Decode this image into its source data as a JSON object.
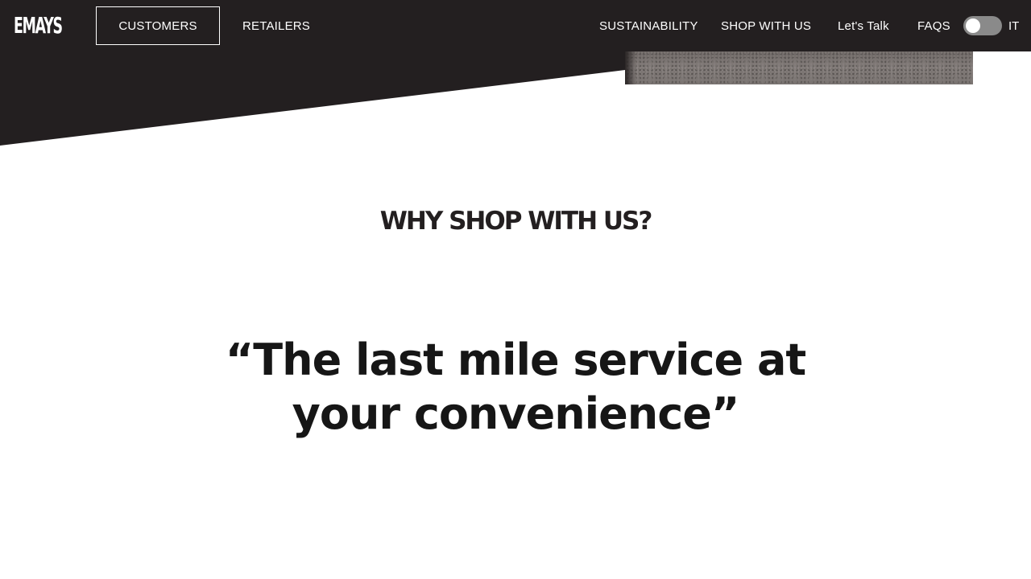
{
  "header": {
    "logo_text": "EMAYS",
    "nav_left": {
      "customers_label": "CUSTOMERS",
      "retailers_label": "RETAILERS"
    },
    "nav_right": {
      "sustainability_label": "SUSTAINABILITY",
      "shop_label": "SHOP WITH US",
      "talk_label": "Let's Talk",
      "faqs_label": "FAQS"
    },
    "language_toggle": {
      "state": "off",
      "label": "IT"
    }
  },
  "colors": {
    "header_bg": "#231f20",
    "text_dark": "#161616",
    "toggle_track": "#8a8a8a"
  },
  "main": {
    "section_title": "WHY SHOP WITH US?",
    "quote": "“The last mile service at your convenience”"
  }
}
